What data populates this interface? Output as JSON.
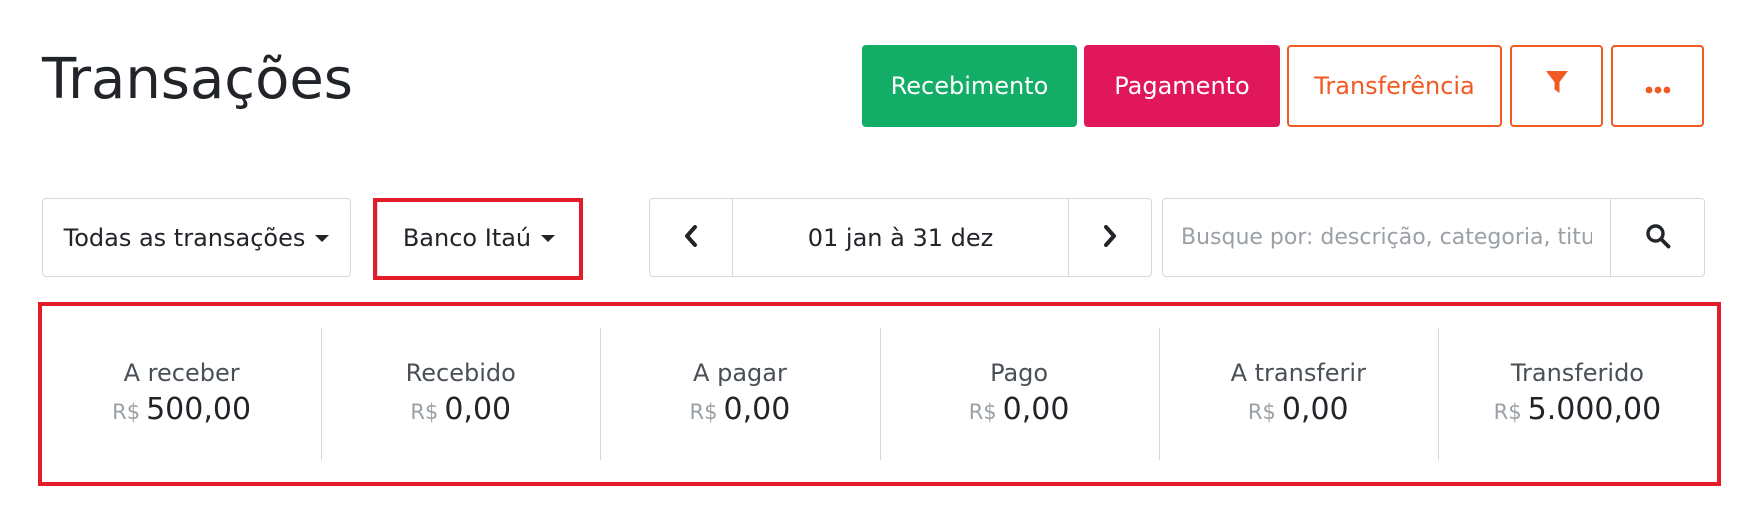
{
  "header": {
    "title": "Transações",
    "actions": {
      "receive_label": "Recebimento",
      "pay_label": "Pagamento",
      "transfer_label": "Transferência"
    }
  },
  "filters": {
    "type_selected": "Todas as transações",
    "account_selected": "Banco Itaú",
    "period": "01 jan à 31 dez",
    "search_placeholder": "Busque por: descrição, categoria, titular..."
  },
  "summary": {
    "currency": "R$",
    "cells": [
      {
        "label": "A receber",
        "amount": "500,00"
      },
      {
        "label": "Recebido",
        "amount": "0,00"
      },
      {
        "label": "A pagar",
        "amount": "0,00"
      },
      {
        "label": "Pago",
        "amount": "0,00"
      },
      {
        "label": "A transferir",
        "amount": "0,00"
      },
      {
        "label": "Transferido",
        "amount": "5.000,00"
      }
    ]
  },
  "icons": {
    "filter": "filter-icon",
    "more": "ellipsis-icon",
    "prev": "chevron-left-icon",
    "next": "chevron-right-icon",
    "search": "search-icon"
  },
  "colors": {
    "success": "#12ad67",
    "danger": "#e0175a",
    "accent": "#f15a22",
    "highlight": "#e31c2a"
  }
}
